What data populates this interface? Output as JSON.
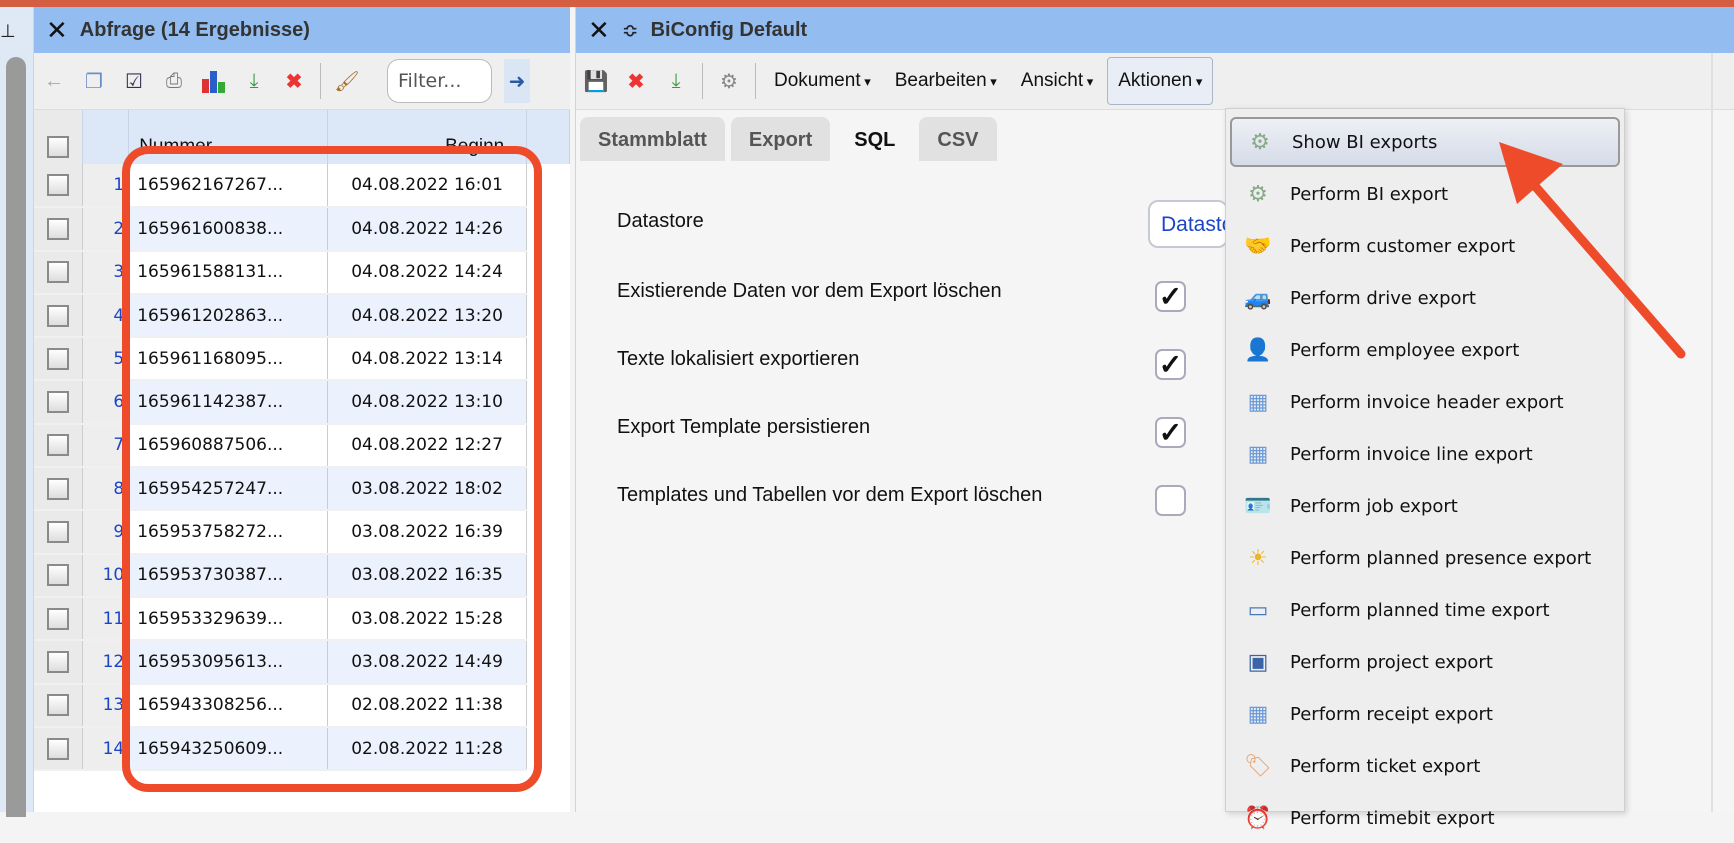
{
  "left_panel": {
    "title": "Abfrage (14 Ergebnisse)",
    "filter_placeholder": "Filter...",
    "columns": [
      "Nummer",
      "Beginn"
    ],
    "rows": [
      {
        "n": "1",
        "nummer": "165962167267...",
        "beginn": "04.08.2022 16:01"
      },
      {
        "n": "2",
        "nummer": "165961600838...",
        "beginn": "04.08.2022 14:26"
      },
      {
        "n": "3",
        "nummer": "165961588131...",
        "beginn": "04.08.2022 14:24"
      },
      {
        "n": "4",
        "nummer": "165961202863...",
        "beginn": "04.08.2022 13:20"
      },
      {
        "n": "5",
        "nummer": "165961168095...",
        "beginn": "04.08.2022 13:14"
      },
      {
        "n": "6",
        "nummer": "165961142387...",
        "beginn": "04.08.2022 13:10"
      },
      {
        "n": "7",
        "nummer": "165960887506...",
        "beginn": "04.08.2022 12:27"
      },
      {
        "n": "8",
        "nummer": "165954257247...",
        "beginn": "03.08.2022 18:02"
      },
      {
        "n": "9",
        "nummer": "165953758272...",
        "beginn": "03.08.2022 16:39"
      },
      {
        "n": "10",
        "nummer": "165953730387...",
        "beginn": "03.08.2022 16:35"
      },
      {
        "n": "11",
        "nummer": "165953329639...",
        "beginn": "03.08.2022 15:28"
      },
      {
        "n": "12",
        "nummer": "165953095613...",
        "beginn": "03.08.2022 14:49"
      },
      {
        "n": "13",
        "nummer": "165943308256...",
        "beginn": "02.08.2022 11:38"
      },
      {
        "n": "14",
        "nummer": "165943250609...",
        "beginn": "02.08.2022 11:28"
      }
    ]
  },
  "right_panel": {
    "title": "BiConfig Default",
    "menus": [
      "Dokument",
      "Bearbeiten",
      "Ansicht",
      "Aktionen"
    ],
    "tabs": [
      "Stammblatt",
      "Export",
      "SQL",
      "CSV"
    ],
    "active_tab": "SQL",
    "form": {
      "datastore_label": "Datastore",
      "datastore_value": "Datastore",
      "options": [
        {
          "label": "Existierende Daten vor dem Export löschen",
          "checked": true
        },
        {
          "label": "Texte lokalisiert exportieren",
          "checked": true
        },
        {
          "label": "Export Template persistieren",
          "checked": true
        },
        {
          "label": "Templates und Tabellen vor dem Export löschen",
          "checked": false
        }
      ]
    }
  },
  "actions_menu": {
    "items": [
      {
        "label": "Show BI exports",
        "icon": "gear-arrow-icon"
      },
      {
        "label": "Perform BI export",
        "icon": "gear-arrow-icon"
      },
      {
        "label": "Perform customer export",
        "icon": "handshake-icon"
      },
      {
        "label": "Perform drive export",
        "icon": "car-icon"
      },
      {
        "label": "Perform employee export",
        "icon": "person-icon"
      },
      {
        "label": "Perform invoice header export",
        "icon": "table-icon"
      },
      {
        "label": "Perform invoice line export",
        "icon": "table-icon"
      },
      {
        "label": "Perform job export",
        "icon": "badge-icon"
      },
      {
        "label": "Perform planned presence export",
        "icon": "sun-icon"
      },
      {
        "label": "Perform planned time export",
        "icon": "folder-icon"
      },
      {
        "label": "Perform project export",
        "icon": "book-icon"
      },
      {
        "label": "Perform receipt export",
        "icon": "table-icon"
      },
      {
        "label": "Perform ticket export",
        "icon": "tag-icon"
      },
      {
        "label": "Perform timebit export",
        "icon": "clock-icon"
      }
    ]
  },
  "colors": {
    "header": "#93bdf0",
    "annotation": "#ee4b2b",
    "link": "#1a45c8"
  }
}
